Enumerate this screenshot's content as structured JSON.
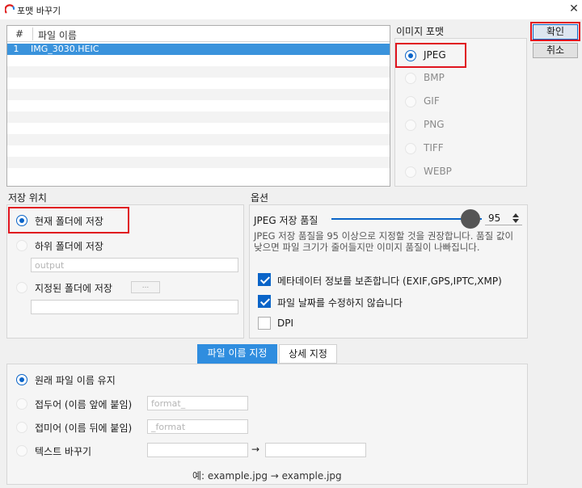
{
  "window": {
    "title": "포맷 바꾸기",
    "close_glyph": "✕"
  },
  "file_list": {
    "columns": [
      "#",
      "파일 이름"
    ],
    "rows": [
      {
        "num": "1",
        "name": "IMG_3030.HEIC"
      }
    ]
  },
  "format": {
    "label": "이미지 포맷",
    "options": [
      "JPEG",
      "BMP",
      "GIF",
      "PNG",
      "TIFF",
      "WEBP"
    ],
    "selected": "JPEG"
  },
  "buttons": {
    "ok": "확인",
    "cancel": "취소"
  },
  "save_location": {
    "label": "저장 위치",
    "options": [
      "현재 폴더에 저장",
      "하위 폴더에 저장",
      "지정된 폴더에 저장"
    ],
    "selected": "현재 폴더에 저장",
    "subfolder_placeholder": "output",
    "browse_label": "..."
  },
  "options": {
    "label": "옵션",
    "quality_label": "JPEG 저장 품질",
    "quality_value": "95",
    "quality_fraction": 0.95,
    "description": "JPEG 저장 품질을 95 이상으로 지정할 것을 권장합니다. 품질 값이 낮으면 파일 크기가 줄어들지만 이미지 품질이 나빠집니다.",
    "checkboxes": [
      {
        "label": "메타데이터 정보를 보존합니다 (EXIF,GPS,IPTC,XMP)",
        "checked": true
      },
      {
        "label": "파일 날짜를 수정하지 않습니다",
        "checked": true
      },
      {
        "label": "DPI",
        "checked": false
      }
    ]
  },
  "tabs": {
    "active": "파일 이름 지정",
    "other": "상세 지정"
  },
  "naming": {
    "options": [
      "원래 파일 이름 유지",
      "접두어 (이름 앞에 붙임)",
      "접미어 (이름 뒤에 붙임)",
      "텍스트 바꾸기"
    ],
    "selected": "원래 파일 이름 유지",
    "prefix_placeholder": "format_",
    "suffix_placeholder": "_format",
    "replace_arrow": "→",
    "example": "예: example.jpg → example.jpg"
  },
  "colors": {
    "accent": "#0a64c8",
    "highlight_box": "#e0141e",
    "tab_active": "#2f8ddf"
  }
}
